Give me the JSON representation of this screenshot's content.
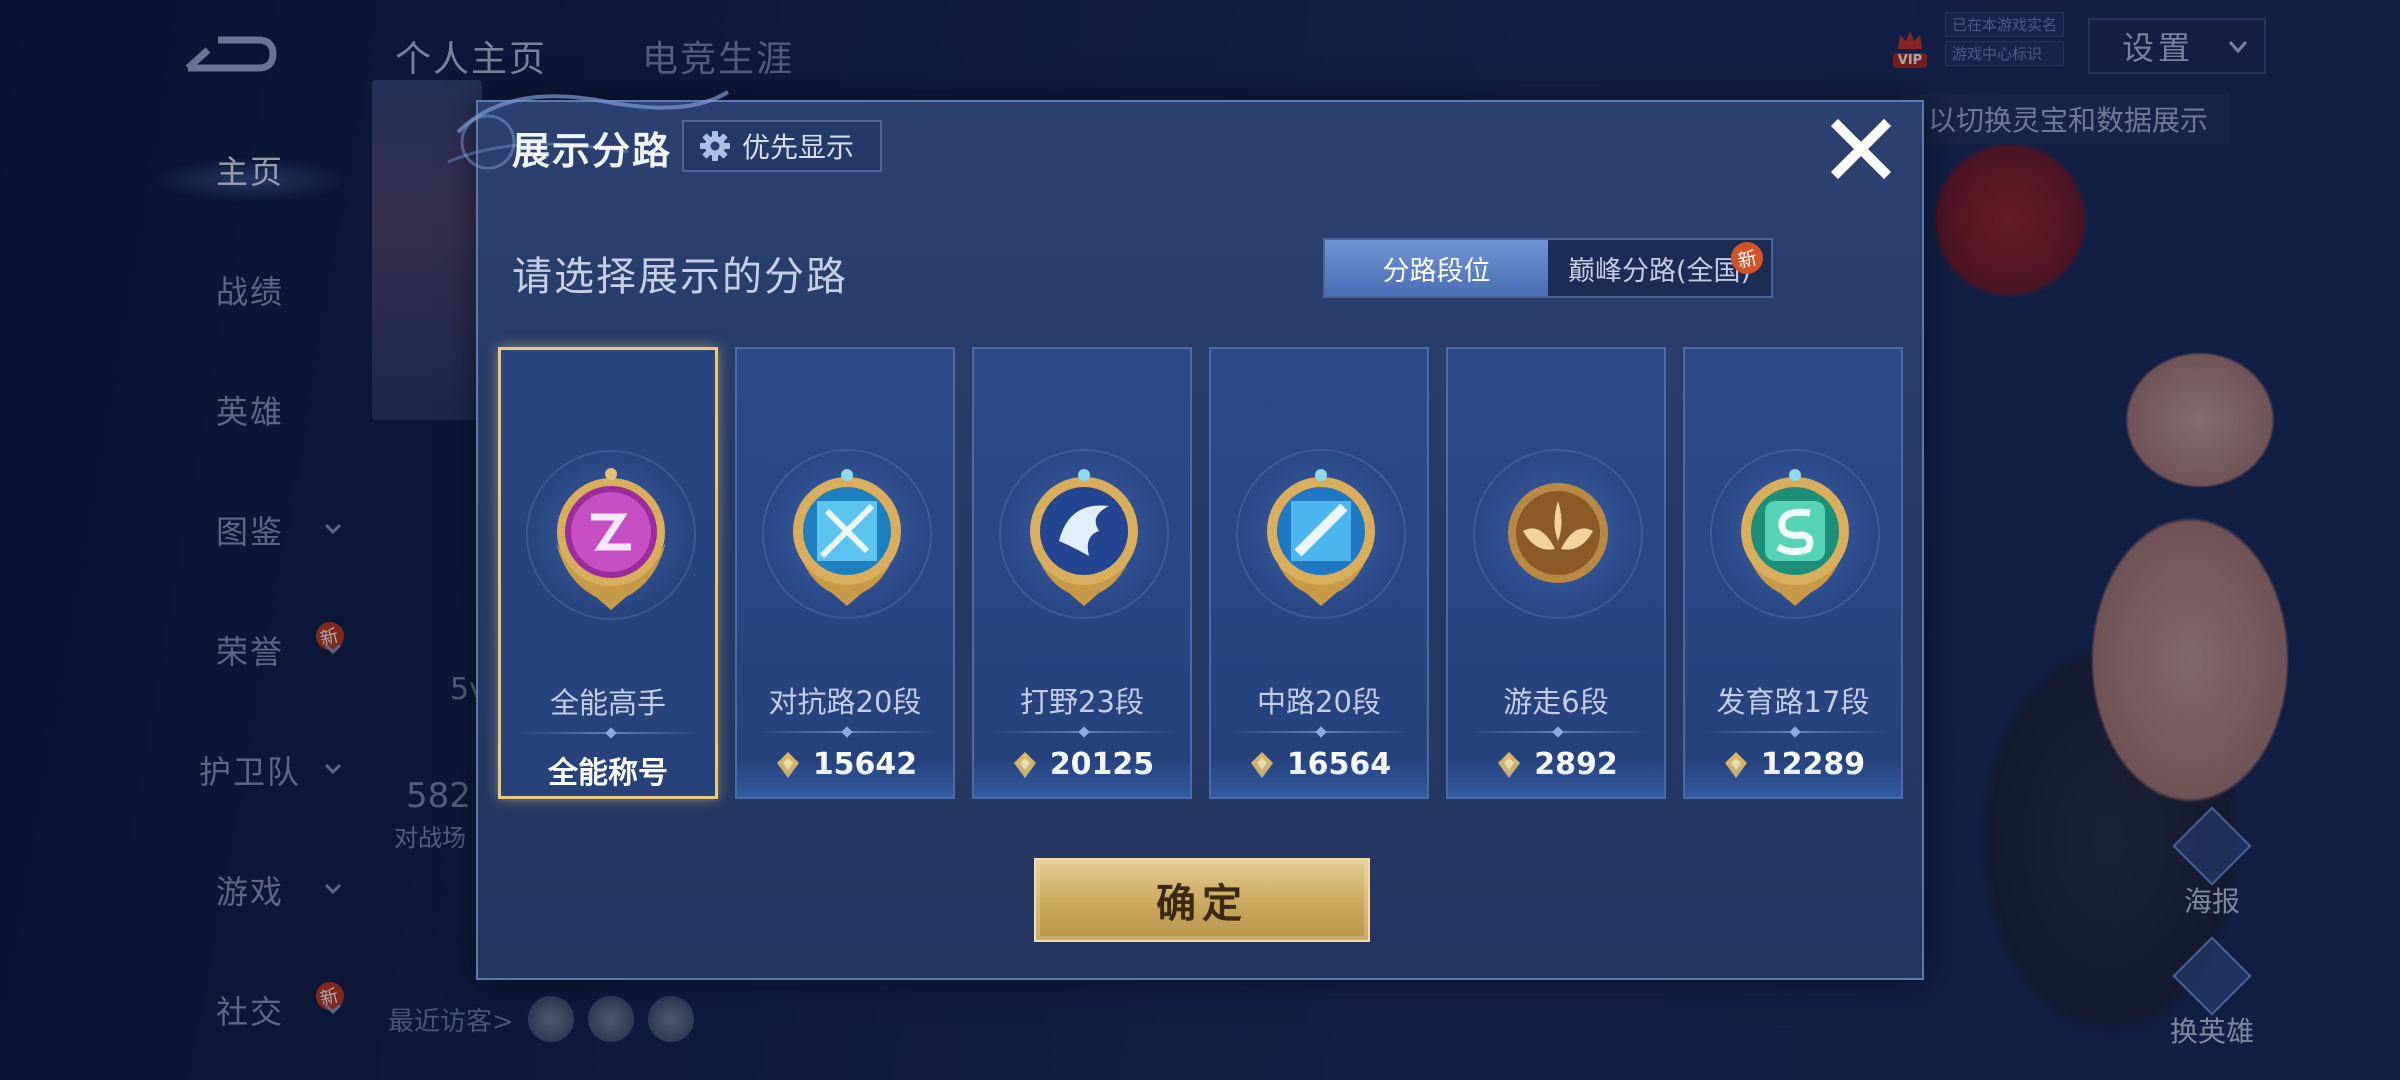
{
  "background": {
    "top_tabs": [
      "个人主页",
      "电竞生涯"
    ],
    "nav": [
      {
        "label": "主页",
        "active": true,
        "chevron": false,
        "new": false
      },
      {
        "label": "战绩",
        "active": false,
        "chevron": false,
        "new": false
      },
      {
        "label": "英雄",
        "active": false,
        "chevron": false,
        "new": false
      },
      {
        "label": "图鉴",
        "active": false,
        "chevron": true,
        "new": false
      },
      {
        "label": "荣誉",
        "active": false,
        "chevron": true,
        "new": true
      },
      {
        "label": "护卫队",
        "active": false,
        "chevron": true,
        "new": false
      },
      {
        "label": "游戏",
        "active": false,
        "chevron": true,
        "new": false
      },
      {
        "label": "社交",
        "active": false,
        "chevron": true,
        "new": true
      }
    ],
    "new_badge": "新",
    "settings_label": "设置",
    "vip_label": "VIP",
    "vip_lines": [
      "已在本游戏实名",
      "游戏中心标识"
    ],
    "hint_text": "以切换灵宝和数据展示",
    "partial_number": "582",
    "partial_caption": "对战场",
    "partial_5v": "5v",
    "recent_visitors_label": "最近访客>",
    "poster_label": "海报",
    "change_hero_label": "换英雄"
  },
  "modal": {
    "title": "展示分路",
    "priority_label": "优先显示",
    "subtitle": "请选择展示的分路",
    "toggle": {
      "left": "分路段位",
      "right": "巅峰分路(全国)",
      "new_tag": "新",
      "selected": "left"
    },
    "cards": [
      {
        "name": "全能高手",
        "value": "全能称号",
        "emblem": "all-round-emblem",
        "has_points": false,
        "selected": true
      },
      {
        "name": "对抗路20段",
        "value": "15642",
        "emblem": "clash-lane-emblem",
        "has_points": true,
        "selected": false
      },
      {
        "name": "打野23段",
        "value": "20125",
        "emblem": "jungle-emblem",
        "has_points": true,
        "selected": false
      },
      {
        "name": "中路20段",
        "value": "16564",
        "emblem": "mid-lane-emblem",
        "has_points": true,
        "selected": false
      },
      {
        "name": "游走6段",
        "value": "2892",
        "emblem": "roam-emblem",
        "has_points": true,
        "selected": false
      },
      {
        "name": "发育路17段",
        "value": "12289",
        "emblem": "farm-lane-emblem",
        "has_points": true,
        "selected": false
      }
    ],
    "confirm_label": "确定"
  },
  "colors": {
    "gold_accent": "#e8c97e",
    "toggle_active": "#5a80c6",
    "confirm_gold": "#c9a95f"
  }
}
